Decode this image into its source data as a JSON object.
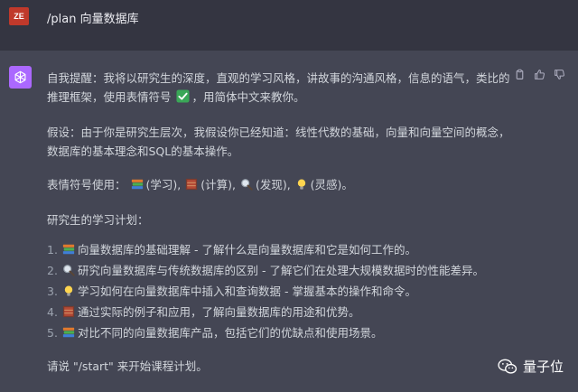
{
  "user": {
    "avatar_initials": "ZE",
    "avatar_color": "#c0392b",
    "message": "/plan 向量数据库"
  },
  "assistant": {
    "avatar_icon": "openai-logo-icon",
    "avatar_color": "#ab68ff",
    "actions": [
      "copy-icon",
      "thumbs-up-icon",
      "thumbs-down-icon"
    ],
    "para1_text": "自我提醒：我将以研究生的深度，直观的学习风格，讲故事的沟通风格，信息的语气，类比的推理框架，使用表情符号",
    "para1_emoji": "check-mark-button-icon",
    "para1_after": "，用简体中文来教你。",
    "para2": "假设：由于你是研究生层次，我假设你已经知道：线性代数的基础，向量和向量空间的概念，数据库的基本理念和SQL的基本操作。",
    "emoji_legend": {
      "prefix": "表情符号使用：",
      "items": [
        {
          "icon": "books-icon",
          "label": "(学习),"
        },
        {
          "icon": "abacus-icon",
          "label": "(计算),"
        },
        {
          "icon": "magnifier-icon",
          "label": "(发现),"
        },
        {
          "icon": "light-bulb-icon",
          "label": "(灵感)。"
        }
      ]
    },
    "plan_heading": "研究生的学习计划：",
    "plan_items": [
      {
        "num": "1.",
        "icon": "books-icon",
        "text": "向量数据库的基础理解 - 了解什么是向量数据库和它是如何工作的。"
      },
      {
        "num": "2.",
        "icon": "magnifier-icon",
        "text": "研究向量数据库与传统数据库的区别 - 了解它们在处理大规模数据时的性能差异。"
      },
      {
        "num": "3.",
        "icon": "light-bulb-icon",
        "text": "学习如何在向量数据库中插入和查询数据 - 掌握基本的操作和命令。"
      },
      {
        "num": "4.",
        "icon": "abacus-icon",
        "text": "通过实际的例子和应用，了解向量数据库的用途和优势。"
      },
      {
        "num": "5.",
        "icon": "books-icon",
        "text": "对比不同的向量数据库产品，包括它们的优缺点和使用场景。"
      }
    ],
    "closing": "请说 \"/start\" 来开始课程计划。"
  },
  "watermark": {
    "icon": "wechat-icon",
    "text": "量子位"
  }
}
